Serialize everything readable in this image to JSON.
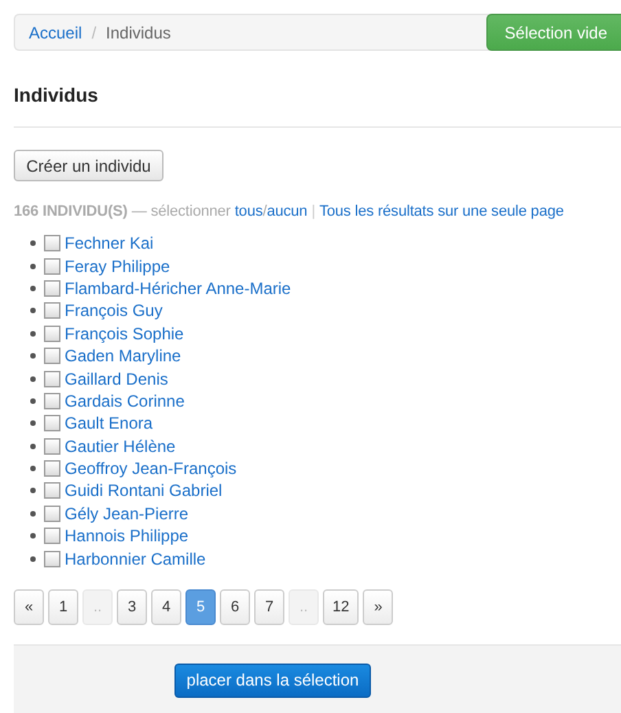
{
  "breadcrumb": [
    {
      "label": "Accueil",
      "link": true
    },
    {
      "label": "Individus",
      "link": false
    }
  ],
  "breadcrumb_separator": "/",
  "selection_button": "Sélection vide",
  "heading": "Individus",
  "create_button": "Créer un individu",
  "summary": {
    "count": "166 INDIVIDU(S)",
    "prompt": "— sélectionner",
    "all": "tous",
    "slash": "/",
    "none": "aucun",
    "separator": "|",
    "single_page": "Tous les résultats sur une seule page"
  },
  "individuals": [
    {
      "name": "Fechner Kai",
      "checked": false
    },
    {
      "name": "Feray Philippe",
      "checked": false
    },
    {
      "name": "Flambard-Héricher Anne-Marie",
      "checked": false
    },
    {
      "name": "François Guy",
      "checked": false
    },
    {
      "name": "François Sophie",
      "checked": false
    },
    {
      "name": "Gaden Maryline",
      "checked": false
    },
    {
      "name": "Gaillard Denis",
      "checked": false
    },
    {
      "name": "Gardais Corinne",
      "checked": false
    },
    {
      "name": "Gault Enora",
      "checked": false
    },
    {
      "name": "Gautier Hélène",
      "checked": false
    },
    {
      "name": "Geoffroy Jean-François",
      "checked": false
    },
    {
      "name": "Guidi Rontani Gabriel",
      "checked": false
    },
    {
      "name": "Gély Jean-Pierre",
      "checked": false
    },
    {
      "name": "Hannois Philippe",
      "checked": false
    },
    {
      "name": "Harbonnier Camille",
      "checked": false
    }
  ],
  "pagination": [
    {
      "label": "«",
      "selected": false,
      "disabled": false
    },
    {
      "label": "1",
      "selected": false,
      "disabled": false
    },
    {
      "label": "..",
      "selected": false,
      "disabled": true
    },
    {
      "label": "3",
      "selected": false,
      "disabled": false
    },
    {
      "label": "4",
      "selected": false,
      "disabled": false
    },
    {
      "label": "5",
      "selected": true,
      "disabled": false
    },
    {
      "label": "6",
      "selected": false,
      "disabled": false
    },
    {
      "label": "7",
      "selected": false,
      "disabled": false
    },
    {
      "label": "..",
      "selected": false,
      "disabled": true
    },
    {
      "label": "12",
      "selected": false,
      "disabled": false
    },
    {
      "label": "»",
      "selected": false,
      "disabled": false
    }
  ],
  "footer_button": "placer dans la sélection"
}
